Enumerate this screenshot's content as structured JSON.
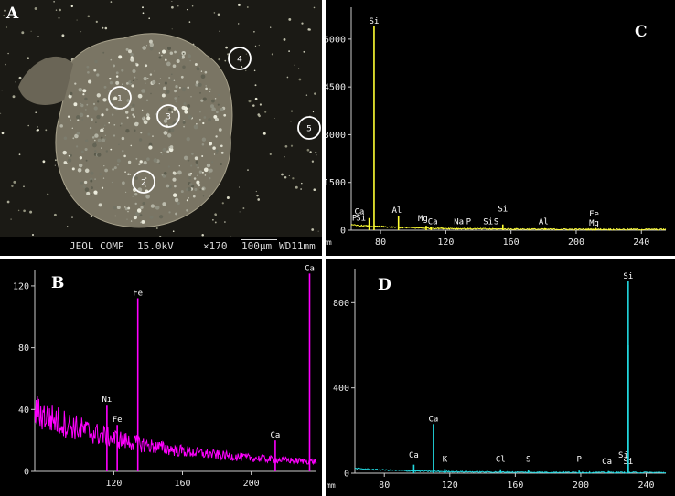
{
  "panels": {
    "A": {
      "letter": "A",
      "spots": [
        "1",
        "2",
        "3",
        "4",
        "5"
      ],
      "info": {
        "detector": "JEOL COMP",
        "voltage": "15.0kV",
        "magnification": "×170",
        "scalebar": "100μm",
        "wd": "WD11mm"
      }
    },
    "B": {
      "letter": "B"
    },
    "C": {
      "letter": "C"
    },
    "D": {
      "letter": "D"
    }
  },
  "chart_data": [
    {
      "panel": "B",
      "type": "line",
      "color": "#ff00ff",
      "xlabel": "",
      "ylabel": "",
      "xlim": [
        74,
        238
      ],
      "ylim": [
        0,
        130
      ],
      "x_ticks": [
        120,
        160,
        200
      ],
      "y_ticks": [
        0,
        40,
        80,
        120
      ],
      "x_unit": "",
      "peaks": [
        {
          "label": "Ni",
          "x": 116,
          "y": 43
        },
        {
          "label": "Fe",
          "x": 122,
          "y": 30
        },
        {
          "label": "Fe",
          "x": 134,
          "y": 112
        },
        {
          "label": "Ca",
          "x": 214,
          "y": 20
        },
        {
          "label": "Ca",
          "x": 234,
          "y": 128
        }
      ],
      "background": {
        "start_x": 74,
        "start_y": 36,
        "end_x": 238,
        "end_y": 3
      }
    },
    {
      "panel": "C",
      "type": "line",
      "color": "#ffff33",
      "xlabel": "",
      "ylabel": "",
      "xlim": [
        62,
        255
      ],
      "ylim": [
        0,
        7000
      ],
      "x_ticks": [
        80,
        120,
        160,
        200,
        240
      ],
      "y_ticks": [
        0,
        1500,
        3000,
        4500,
        6000
      ],
      "x_unit": "mm",
      "peaks": [
        {
          "label": "Si",
          "x": 76,
          "y": 6400
        },
        {
          "label": "Ca",
          "x": 73,
          "y": 380
        },
        {
          "label": "Al",
          "x": 91,
          "y": 450
        },
        {
          "label": "Mg",
          "x": 108,
          "y": 140
        },
        {
          "label": "Ca",
          "x": 111,
          "y": 90
        },
        {
          "label": "Si",
          "x": 155,
          "y": 180
        },
        {
          "label": "Al",
          "x": 181,
          "y": 60
        },
        {
          "label": "Fe",
          "x": 212,
          "y": 70
        },
        {
          "label": "Mg",
          "x": 212,
          "y": 40
        }
      ],
      "annotations": [
        {
          "label": "Si",
          "x": 76,
          "y": 6400
        },
        {
          "label": "Ca",
          "x": 67,
          "y": 420
        },
        {
          "label": "P",
          "x": 64,
          "y": 220
        },
        {
          "label": "Si",
          "x": 68,
          "y": 220
        },
        {
          "label": "Al",
          "x": 90,
          "y": 460
        },
        {
          "label": "Mg",
          "x": 106,
          "y": 200
        },
        {
          "label": "Ca",
          "x": 112,
          "y": 100
        },
        {
          "label": "Na",
          "x": 128,
          "y": 100
        },
        {
          "label": "P",
          "x": 134,
          "y": 100
        },
        {
          "label": "Si",
          "x": 146,
          "y": 100
        },
        {
          "label": "S",
          "x": 151,
          "y": 100
        },
        {
          "label": "Si",
          "x": 155,
          "y": 500
        },
        {
          "label": "Al",
          "x": 180,
          "y": 100
        },
        {
          "label": "Fe",
          "x": 211,
          "y": 350
        },
        {
          "label": "Mg",
          "x": 211,
          "y": 60
        }
      ]
    },
    {
      "panel": "D",
      "type": "line",
      "color": "#22d8e0",
      "xlabel": "",
      "ylabel": "",
      "xlim": [
        62,
        252
      ],
      "ylim": [
        0,
        960
      ],
      "x_ticks": [
        80,
        120,
        160,
        200,
        240
      ],
      "y_ticks": [
        0,
        400,
        800
      ],
      "x_unit": "mm",
      "peaks": [
        {
          "label": "Ca",
          "x": 98,
          "y": 40
        },
        {
          "label": "Ca",
          "x": 110,
          "y": 230
        },
        {
          "label": "K",
          "x": 117,
          "y": 20
        },
        {
          "label": "Cl",
          "x": 151,
          "y": 18
        },
        {
          "label": "S",
          "x": 168,
          "y": 15
        },
        {
          "label": "P",
          "x": 199,
          "y": 12
        },
        {
          "label": "Ca",
          "x": 217,
          "y": 10
        },
        {
          "label": "Si",
          "x": 229,
          "y": 900
        },
        {
          "label": "Si",
          "x": 229,
          "y": 600
        }
      ],
      "annotations": [
        {
          "label": "Si",
          "x": 229,
          "y": 900
        },
        {
          "label": "Ca",
          "x": 110,
          "y": 230
        },
        {
          "label": "Ca",
          "x": 98,
          "y": 60
        },
        {
          "label": "K",
          "x": 117,
          "y": 40
        },
        {
          "label": "Cl",
          "x": 151,
          "y": 40
        },
        {
          "label": "S",
          "x": 168,
          "y": 40
        },
        {
          "label": "P",
          "x": 199,
          "y": 40
        },
        {
          "label": "Ca",
          "x": 216,
          "y": 30
        },
        {
          "label": "Si",
          "x": 226,
          "y": 60
        },
        {
          "label": "Si",
          "x": 229,
          "y": 30
        }
      ]
    }
  ]
}
